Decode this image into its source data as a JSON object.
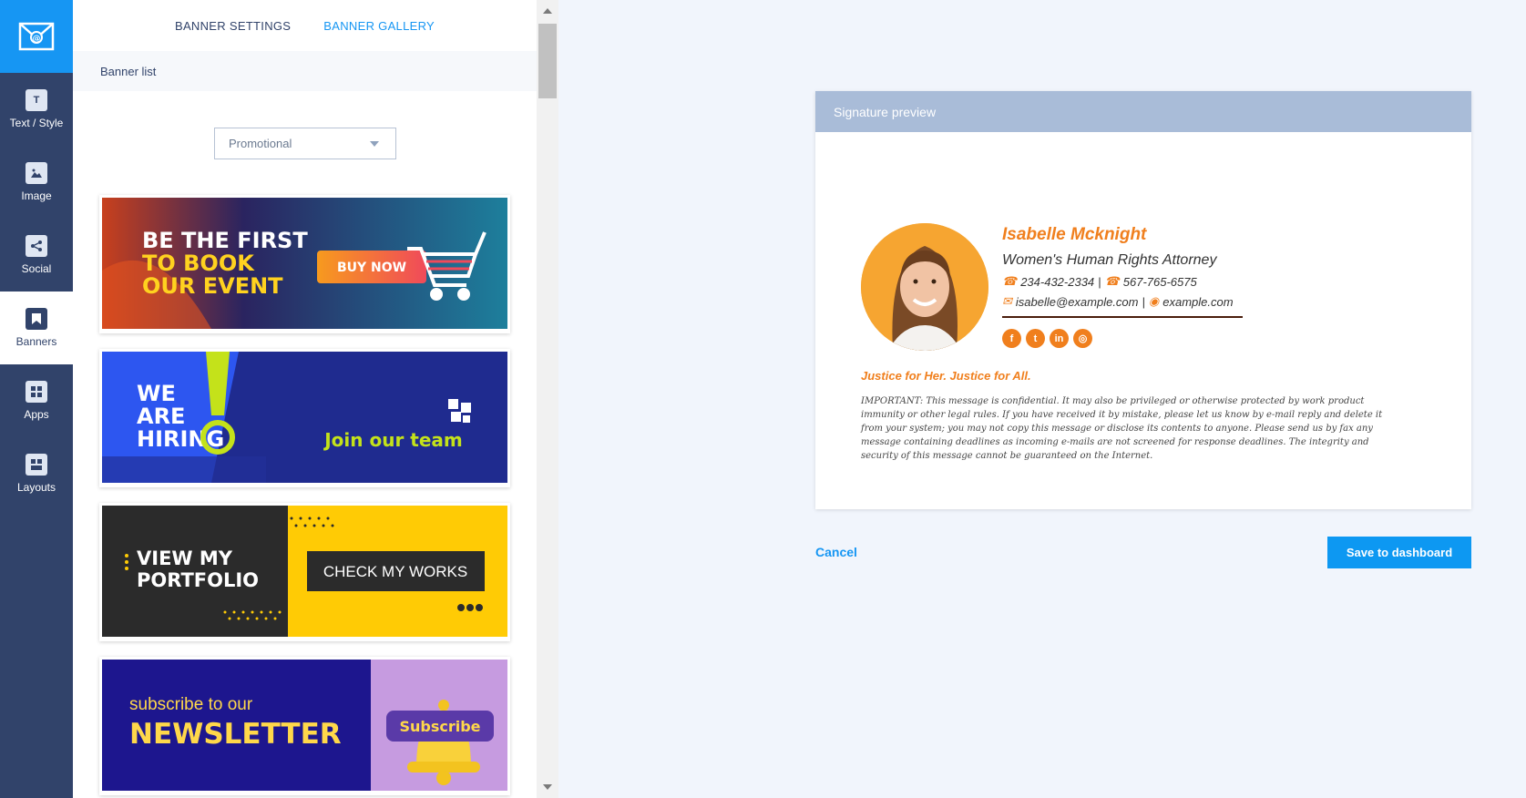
{
  "nav": {
    "items": [
      {
        "label": "Text / Style",
        "icon": "text-style-icon"
      },
      {
        "label": "Image",
        "icon": "image-icon"
      },
      {
        "label": "Social",
        "icon": "share-icon"
      },
      {
        "label": "Banners",
        "icon": "bookmark-icon"
      },
      {
        "label": "Apps",
        "icon": "apps-icon"
      },
      {
        "label": "Layouts",
        "icon": "layouts-icon"
      }
    ],
    "active": "Banners"
  },
  "panel": {
    "tabs": [
      "BANNER SETTINGS",
      "BANNER GALLERY"
    ],
    "active_tab": "BANNER GALLERY",
    "list_header": "Banner list",
    "category_select": "Promotional"
  },
  "banners": [
    {
      "lines": [
        "BE THE FIRST",
        "TO BOOK",
        "OUR EVENT"
      ],
      "button": "BUY NOW"
    },
    {
      "lines": [
        "WE",
        "ARE",
        "HIRING"
      ],
      "button": "Join our team"
    },
    {
      "lines": [
        "VIEW MY",
        "PORTFOLIO"
      ],
      "button": "CHECK MY WORKS"
    },
    {
      "lines": [
        "subscribe to our",
        "NEWSLETTER"
      ],
      "button": "Subscribe"
    }
  ],
  "preview": {
    "header": "Signature preview",
    "name": "Isabelle Mcknight",
    "title": "Women's Human Rights Attorney",
    "phone1": "234-432-2334",
    "phone2": "567-765-6575",
    "email": "isabelle@example.com",
    "website": "example.com",
    "separator": "|",
    "socials": [
      "facebook",
      "twitter",
      "linkedin",
      "instagram"
    ],
    "tagline": "Justice for Her. Justice for All.",
    "disclaimer": "IMPORTANT: This message is confidential. It may also be privileged or otherwise protected by work product immunity or other legal rules. If you have received it by mistake, please let us know by e-mail reply and delete it from your system; you may not copy this message or disclose its contents to anyone. Please send us by fax any message containing deadlines as incoming e-mails are not screened for response deadlines. The integrity and security of this message cannot be guaranteed on the Internet."
  },
  "actions": {
    "cancel": "Cancel",
    "save": "Save to dashboard"
  },
  "colors": {
    "rail": "#31436a",
    "accent": "#1696f3",
    "signature_accent": "#f07f1d",
    "preview_header": "#a9bcd8"
  }
}
